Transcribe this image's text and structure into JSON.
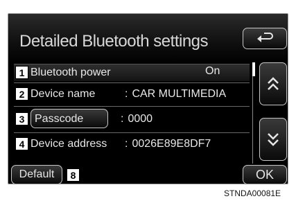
{
  "screen": {
    "title": "Detailed Bluetooth settings",
    "rows": [
      {
        "badge": "1",
        "label": "Bluetooth power",
        "separator": "",
        "value": "On"
      },
      {
        "badge": "2",
        "label": "Device name",
        "separator": ":",
        "value": "CAR MULTIMEDIA"
      },
      {
        "badge": "3",
        "label": "Passcode",
        "separator": ":",
        "value": "0000"
      },
      {
        "badge": "4",
        "label": "Device address",
        "separator": ":",
        "value": "0026E89E8DF7"
      }
    ],
    "default_label": "Default",
    "default_badge": "8",
    "ok_label": "OK"
  },
  "icons": {
    "back": "back-arrow-icon",
    "up": "double-chevron-up-icon",
    "down": "double-chevron-down-icon"
  },
  "caption": "STNDA00081E",
  "colors": {
    "background": "#000000",
    "text": "#e8e8e8",
    "badge_bg": "#ffffff"
  }
}
